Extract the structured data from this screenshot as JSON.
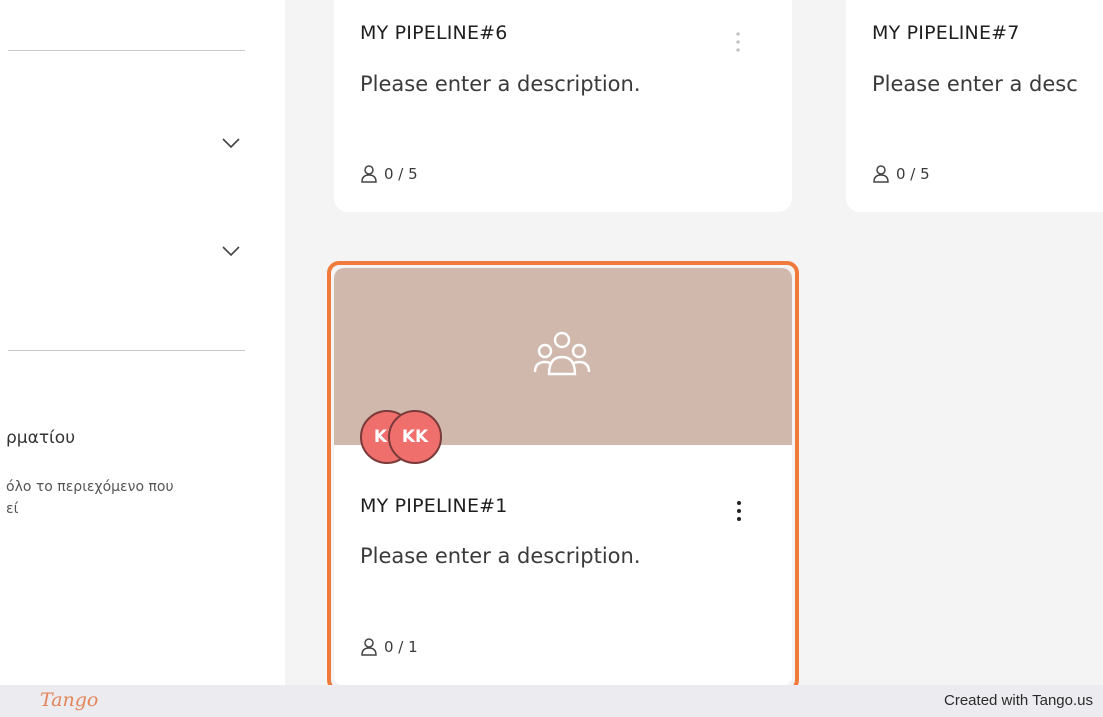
{
  "sidebar": {
    "room_title": "ρματίου",
    "room_desc_line1": "όλο το περιεχόμενο που",
    "room_desc_line2": "εί"
  },
  "pipelines": [
    {
      "title": "MY PIPELINE#6",
      "description": "Please enter a description.",
      "members": "0 / 5"
    },
    {
      "title": "MY PIPELINE#7",
      "description": "Please enter a desc",
      "members": "0 / 5"
    },
    {
      "title": "MY PIPELINE#1",
      "description": "Please enter a description.",
      "members": "0 / 1",
      "avatars": [
        "KK",
        "KK"
      ],
      "banner_color": "#d0b8ad"
    }
  ],
  "highlight_color": "#f07a3b",
  "footer": {
    "logo": "Tango",
    "credit": "Created with Tango.us"
  }
}
